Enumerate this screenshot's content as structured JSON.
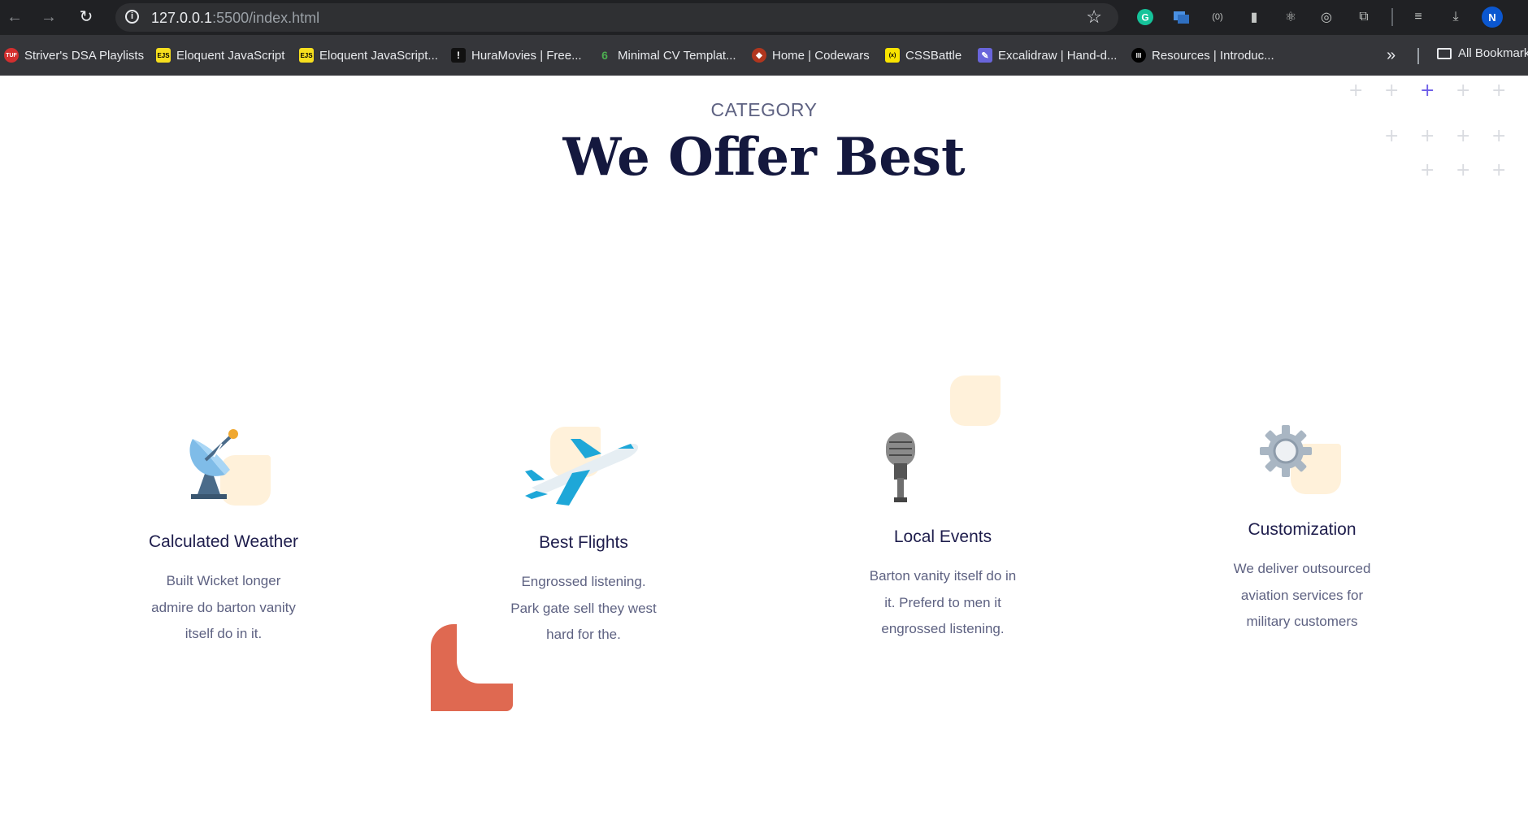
{
  "browser": {
    "url_host": "127.0.0.1",
    "url_path": ":5500/index.html",
    "avatar_letter": "N",
    "bookmarks": [
      {
        "label": "Striver's DSA Playlists",
        "icon_text": "TUF",
        "icon_bg": "#d32f2f"
      },
      {
        "label": "Eloquent JavaScript",
        "icon_text": "EJS",
        "icon_bg": "#f7df1e"
      },
      {
        "label": "Eloquent JavaScript...",
        "icon_text": "EJS",
        "icon_bg": "#f7df1e"
      },
      {
        "label": "HuraMovies | Free...",
        "icon_text": "!",
        "icon_bg": "#111111"
      },
      {
        "label": "Minimal CV Templat...",
        "icon_text": "6",
        "icon_bg": "#35363a"
      },
      {
        "label": "Home | Codewars",
        "icon_text": "◆",
        "icon_bg": "#b1361e"
      },
      {
        "label": "CSSBattle",
        "icon_text": "(x)",
        "icon_bg": "#f9e400"
      },
      {
        "label": "Excalidraw | Hand-d...",
        "icon_text": "✎",
        "icon_bg": "#6965db"
      },
      {
        "label": "Resources | Introduc...",
        "icon_text": "III",
        "icon_bg": "#000000"
      }
    ],
    "all_bookmarks": "All Bookmarks"
  },
  "page": {
    "eyebrow": "CATEGORY",
    "headline": "We Offer Best",
    "cards": [
      {
        "icon": "satellite-dish-icon",
        "title": "Calculated Weather",
        "desc": "Built Wicket longer admire do barton vanity itself do in it."
      },
      {
        "icon": "airplane-icon",
        "title": "Best Flights",
        "desc": "Engrossed listening. Park gate sell they west hard for the."
      },
      {
        "icon": "microphone-icon",
        "title": "Local Events",
        "desc": "Barton vanity itself do in it. Preferd to men it engrossed listening."
      },
      {
        "icon": "gear-icon",
        "title": "Customization",
        "desc": "We deliver outsourced aviation services for military customers"
      }
    ]
  },
  "colors": {
    "heading": "#14183e",
    "body_text": "#5e6282",
    "blob": "#fff1da",
    "accent_orange": "#df6951",
    "plus_accent": "#6c5ce7"
  }
}
